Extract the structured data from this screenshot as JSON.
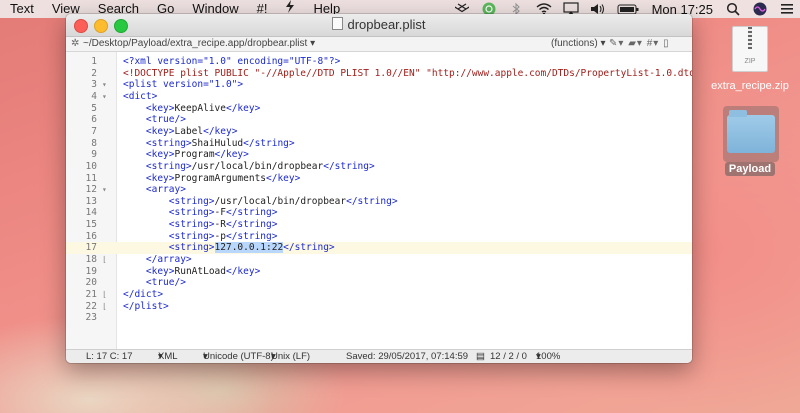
{
  "menubar": {
    "items": [
      "Text",
      "View",
      "Search",
      "Go",
      "Window",
      "#!",
      "Help"
    ],
    "clock": "Mon 17:25"
  },
  "desktop": {
    "zip_label": "extra_recipe.zip",
    "zip_badge": "ZIP",
    "folder_label": "Payload"
  },
  "window": {
    "title": "dropbear.plist",
    "path": "~/Desktop/Payload/extra_recipe.app/dropbear.plist",
    "functions_label": "(functions)",
    "lines": [
      "<?xml version=\"1.0\" encoding=\"UTF-8\"?>",
      "<!DOCTYPE plist PUBLIC \"-//Apple//DTD PLIST 1.0//EN\" \"http://www.apple.com/DTDs/PropertyList-1.0.dtd\">",
      "<plist version=\"1.0\">",
      "<dict>",
      "    <key>KeepAlive</key>",
      "    <true/>",
      "    <key>Label</key>",
      "    <string>ShaiHulud</string>",
      "    <key>Program</key>",
      "    <string>/usr/local/bin/dropbear</string>",
      "    <key>ProgramArguments</key>",
      "    <array>",
      "        <string>/usr/local/bin/dropbear</string>",
      "        <string>-F</string>",
      "        <string>-R</string>",
      "        <string>-p</string>",
      "        <string>127.0.0.1:22</string>",
      "    </array>",
      "    <key>RunAtLoad</key>",
      "    <true/>",
      "</dict>",
      "</plist>",
      ""
    ],
    "status": {
      "position": "L: 17 C: 17",
      "language": "XML",
      "encoding": "Unicode (UTF-8)",
      "line_endings": "Unix (LF)",
      "saved": "Saved: 29/05/2017, 07:14:59",
      "stats": "12 / 2 / 0",
      "zoom": "100%"
    }
  }
}
